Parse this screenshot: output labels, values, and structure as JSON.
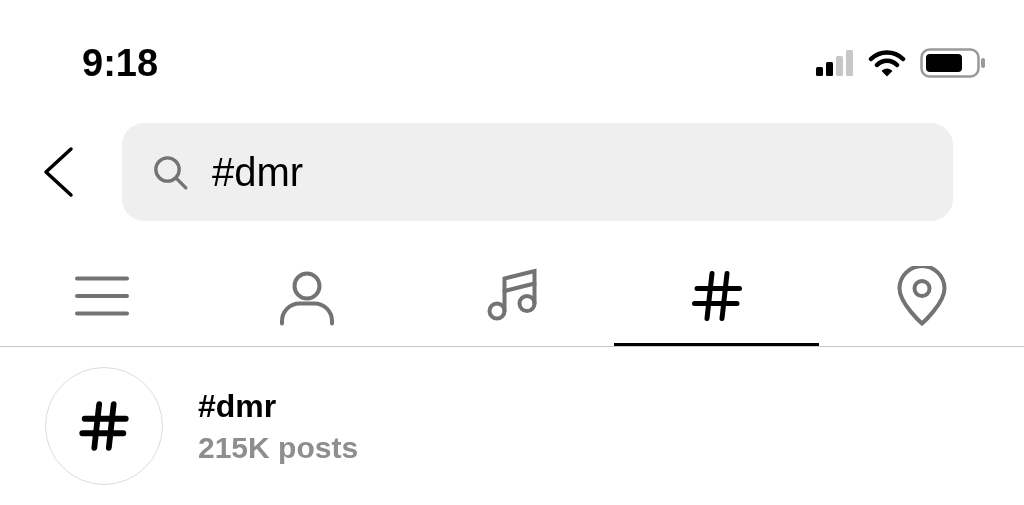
{
  "status_bar": {
    "time": "9:18"
  },
  "search": {
    "value": "#dmr"
  },
  "tabs": [
    {
      "kind": "top",
      "selected": false
    },
    {
      "kind": "accounts",
      "selected": false
    },
    {
      "kind": "audio",
      "selected": false
    },
    {
      "kind": "tags",
      "selected": true
    },
    {
      "kind": "places",
      "selected": false
    }
  ],
  "results": [
    {
      "title": "#dmr",
      "subtitle": "215K posts"
    }
  ]
}
